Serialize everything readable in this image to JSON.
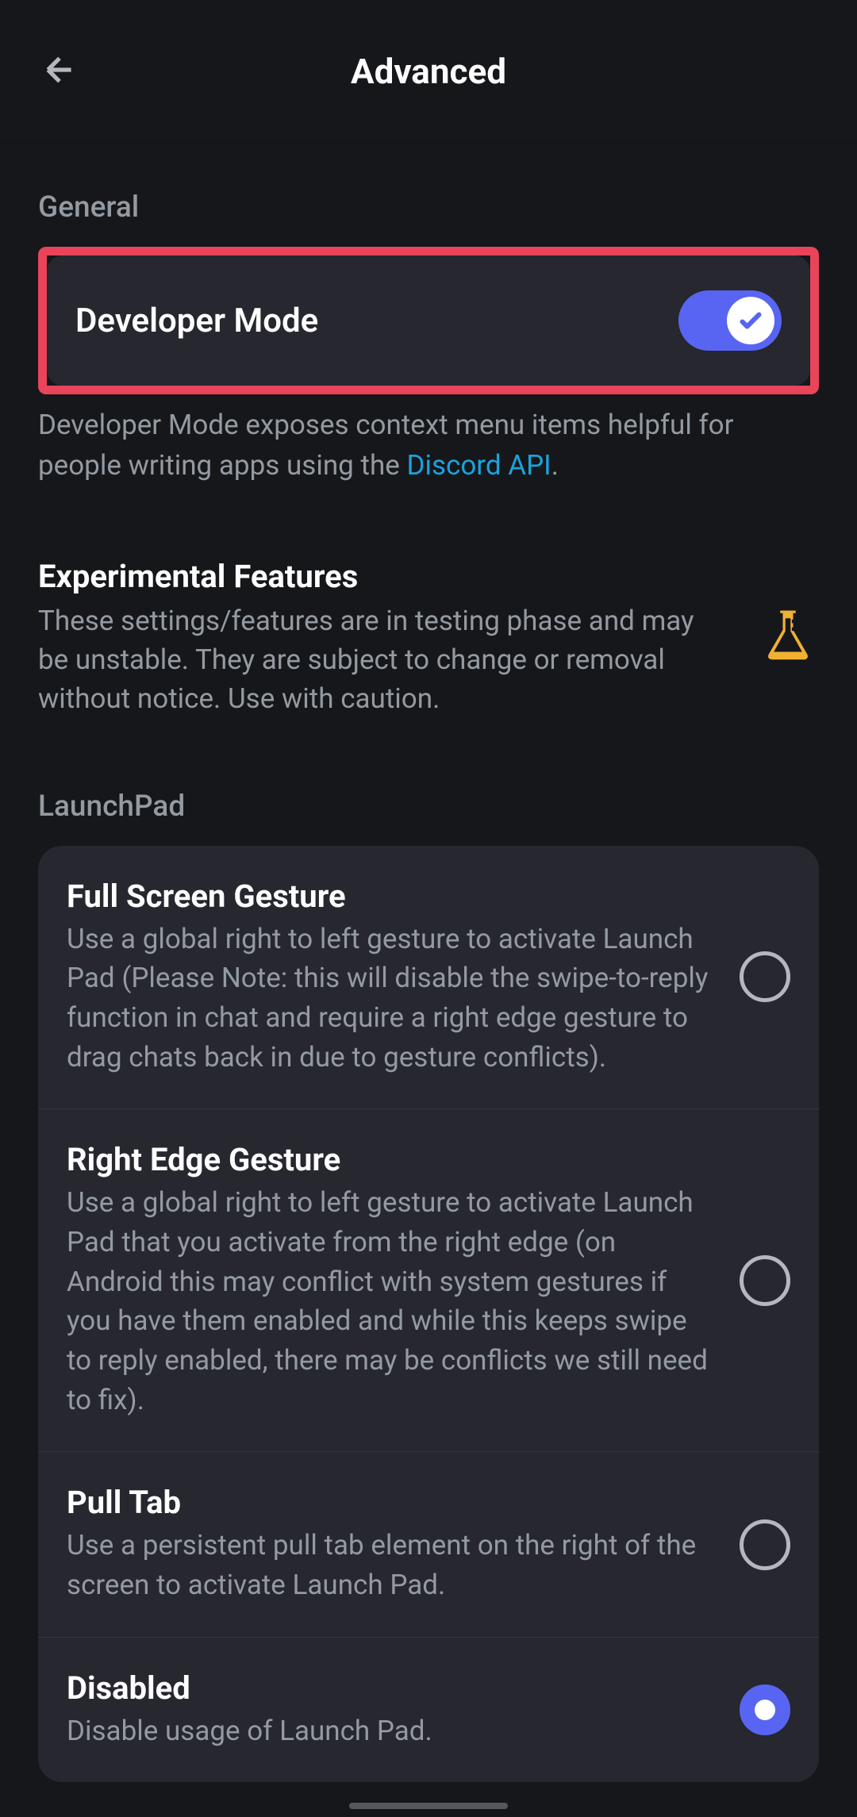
{
  "header": {
    "title": "Advanced"
  },
  "general": {
    "label": "General",
    "devModeLabel": "Developer Mode",
    "devModeDesc1": "Developer Mode exposes context menu items helpful for people writing apps using the ",
    "devModeLink": "Discord API",
    "devModeDesc2": "."
  },
  "experimental": {
    "title": "Experimental Features",
    "desc": "These settings/features are in testing phase and may be unstable. They are subject to change or removal without notice. Use with caution."
  },
  "launchpad": {
    "label": "LaunchPad",
    "options": [
      {
        "title": "Full Screen Gesture",
        "desc": "Use a global right to left gesture to activate Launch Pad (Please Note: this will disable the swipe-to-reply function in chat and require a right edge gesture to drag chats back in due to gesture conflicts).",
        "selected": false
      },
      {
        "title": "Right Edge Gesture",
        "desc": "Use a global right to left gesture to activate Launch Pad that you activate from the right edge (on Android this may conflict with system gestures if you have them enabled and while this keeps swipe to reply enabled, there may be conflicts we still need to fix).",
        "selected": false
      },
      {
        "title": "Pull Tab",
        "desc": "Use a persistent pull tab element on the right of the screen to activate Launch Pad.",
        "selected": false
      },
      {
        "title": "Disabled",
        "desc": "Disable usage of Launch Pad.",
        "selected": true
      }
    ]
  }
}
